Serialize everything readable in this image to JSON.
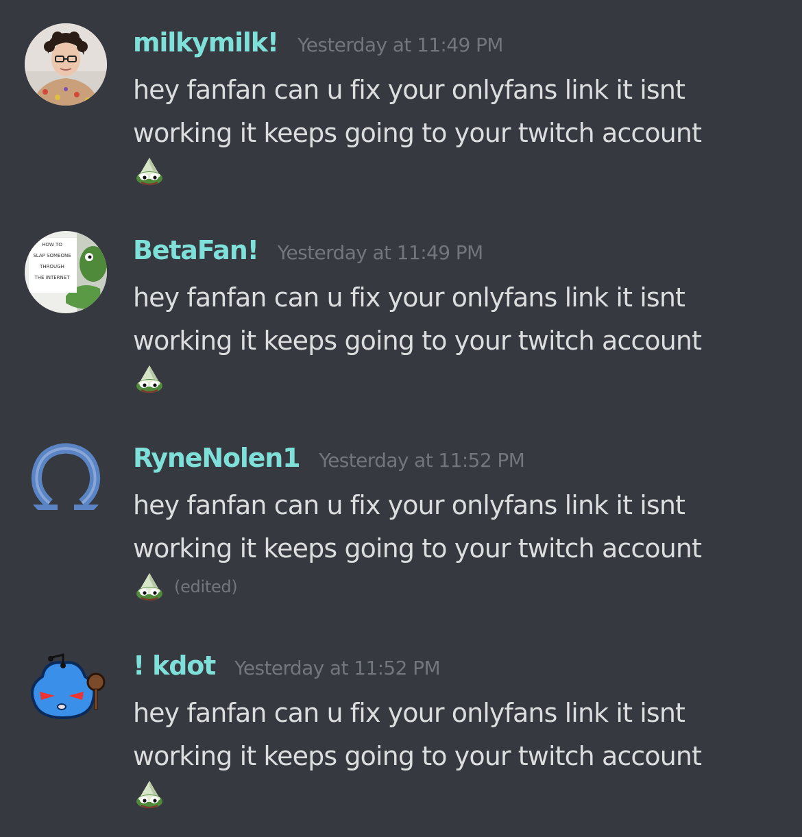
{
  "theme": {
    "background": "#36393f",
    "username_color": "#7ee0d8",
    "text_color": "#dcddde",
    "muted_color": "#72767d"
  },
  "messages": [
    {
      "username": "milkymilk!",
      "timestamp": "Yesterday at 11:49 PM",
      "text_line1": "hey fanfan can u fix your onlyfans link it isnt",
      "text_line2": "working it keeps going to your twitch account",
      "emote": "pepe-wizard-emote",
      "edited": ""
    },
    {
      "username": "BetaFan!",
      "timestamp": "Yesterday at 11:49 PM",
      "text_line1": "hey fanfan can u fix your onlyfans link it isnt",
      "text_line2": "working it keeps going to your twitch account",
      "emote": "pepe-wizard-emote",
      "edited": "",
      "avatar_caption": [
        "HOW TO",
        "SLAP SOMEONE",
        "THROUGH",
        "THE INTERNET"
      ]
    },
    {
      "username": "RyneNolen1",
      "timestamp": "Yesterday at 11:52 PM",
      "text_line1": "hey fanfan can u fix your onlyfans link it isnt",
      "text_line2": "working it keeps going to your twitch account",
      "emote": "pepe-wizard-emote",
      "edited": "(edited)"
    },
    {
      "username": "! kdot",
      "timestamp": "Yesterday at 11:52 PM",
      "text_line1": "hey fanfan can u fix your onlyfans link it isnt",
      "text_line2": "working it keeps going to your twitch account",
      "emote": "pepe-wizard-emote",
      "edited": ""
    }
  ]
}
